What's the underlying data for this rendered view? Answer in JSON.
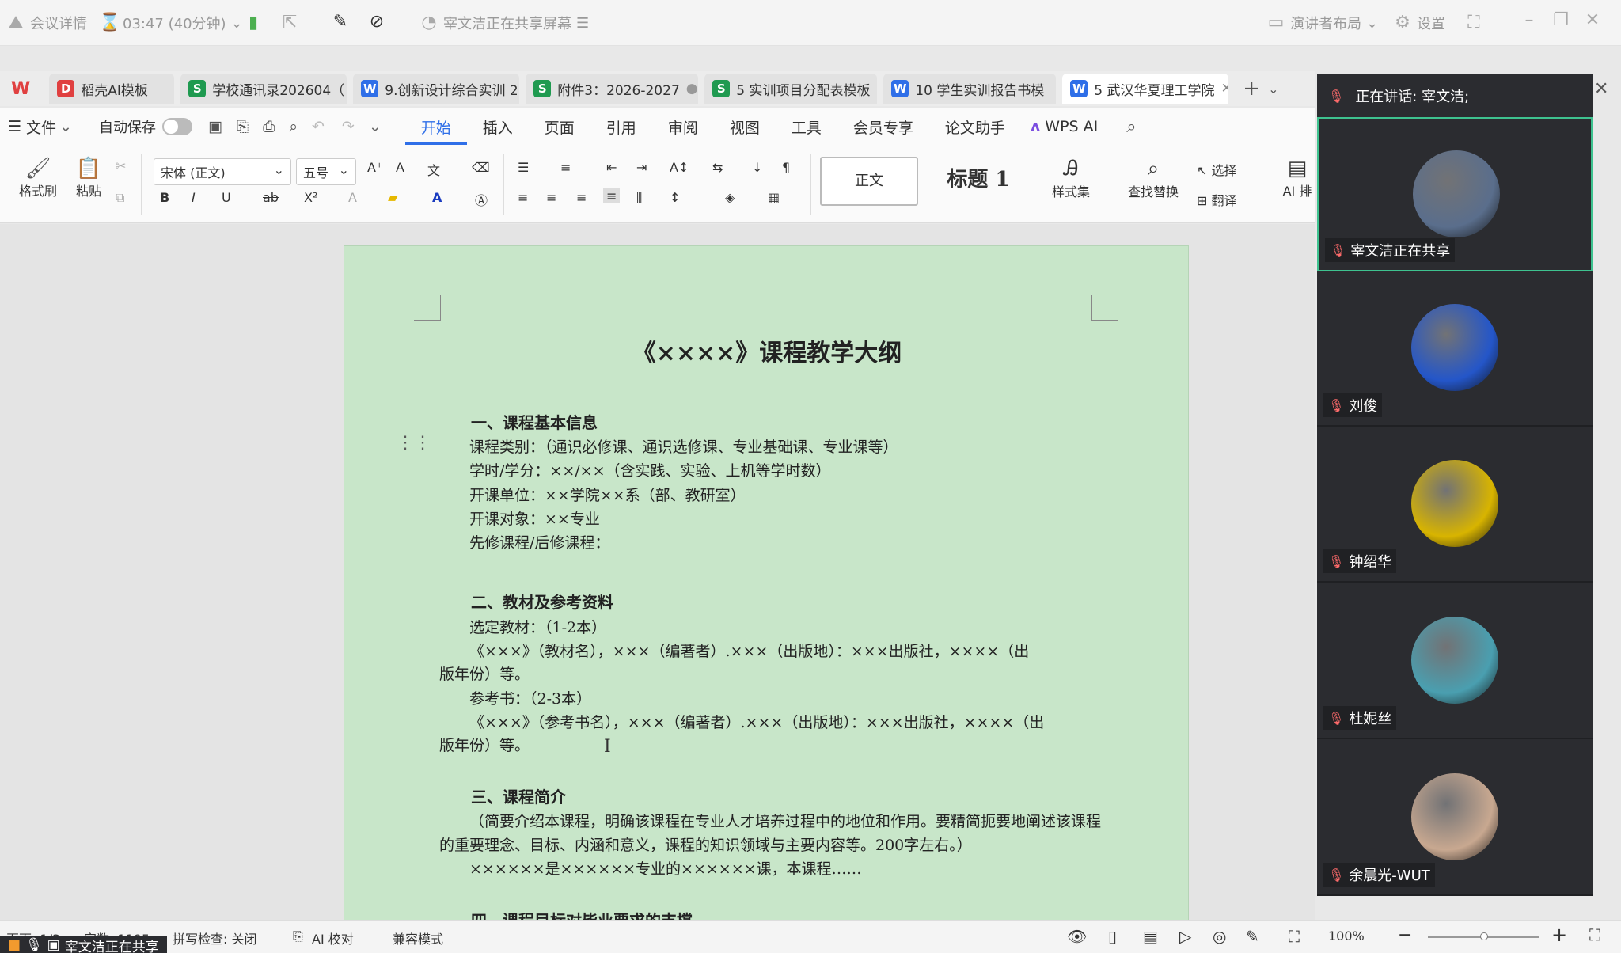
{
  "meeting": {
    "details_label": "会议详情",
    "timer": "03:47 (40分钟)",
    "sharing_status": "宰文洁正在共享屏幕",
    "presenter_layout": "演讲者布局",
    "settings": "设置"
  },
  "tabs": [
    {
      "icon": "D",
      "label": "稻壳AI模板"
    },
    {
      "icon": "S",
      "label": "学校通讯录202604（"
    },
    {
      "icon": "W",
      "label": "9.创新设计综合实训 2"
    },
    {
      "icon": "S",
      "label": "附件3：2026-2027"
    },
    {
      "icon": "S",
      "label": "5 实训项目分配表模板"
    },
    {
      "icon": "W",
      "label": "10 学生实训报告书模"
    },
    {
      "icon": "W",
      "label": "5 武汉华夏理工学院"
    }
  ],
  "menu": {
    "file": "文件",
    "autosave": "自动保存",
    "items": [
      "开始",
      "插入",
      "页面",
      "引用",
      "审阅",
      "视图",
      "工具",
      "会员专享",
      "论文助手"
    ],
    "wps_ai": "WPS AI"
  },
  "ribbon": {
    "format_painter": "格式刷",
    "paste": "粘贴",
    "font": "宋体 (正文)",
    "size": "五号",
    "style_normal": "正文",
    "style_heading": "标题 1",
    "style_set": "样式集",
    "find_replace": "查找替换",
    "select": "选择",
    "translate": "翻译",
    "ai_layout": "AI 排"
  },
  "document": {
    "title": "《××××》课程教学大纲",
    "lines": [
      {
        "t": "一、课程基本信息",
        "h": true
      },
      {
        "t": "课程类别：（通识必修课、通识选修课、专业基础课、专业课等）"
      },
      {
        "t": "学时/学分：××/××（含实践、实验、上机等学时数）"
      },
      {
        "t": "开课单位：××学院××系（部、教研室）"
      },
      {
        "t": "开课对象：××专业"
      },
      {
        "t": "先修课程/后修课程："
      },
      {
        "t": "二、教材及参考资料",
        "h": true
      },
      {
        "t": "选定教材：（1-2本）"
      },
      {
        "t": "《×××》（教材名），×××（编著者）.×××（出版地）：×××出版社，××××（出"
      },
      {
        "t": "版年份）等。"
      },
      {
        "t": "参考书：（2-3本）"
      },
      {
        "t": "《×××》（参考书名），×××（编著者）.×××（出版地）：×××出版社，××××（出"
      },
      {
        "t": "版年份）等。"
      },
      {
        "t": "三、课程简介",
        "h": true
      },
      {
        "t": "（简要介绍本课程，明确该课程在专业人才培养过程中的地位和作用。要精简扼要地阐述该课程"
      },
      {
        "t": "的重要理念、目标、内涵和意义，课程的知识领域与主要内容等。200字左右。）"
      },
      {
        "t": "××××××是××××××专业的××××××课，本课程……"
      },
      {
        "t": "四、课程目标对毕业要求的支撑",
        "h": true
      }
    ]
  },
  "status": {
    "page": "页面: 1/3",
    "words": "字数: 1195",
    "spellcheck": "拼写检查: 关闭",
    "ai_check": "AI 校对",
    "compat": "兼容模式",
    "zoom": "100%",
    "sharing": "宰文洁正在共享"
  },
  "panel": {
    "speaking": "正在讲话:  宰文洁;",
    "participants": [
      {
        "name": "宰文洁正在共享",
        "color": "#5a6e8c"
      },
      {
        "name": "刘俊",
        "color": "#2456c9"
      },
      {
        "name": "钟绍华",
        "color": "#d8b400"
      },
      {
        "name": "杜妮丝",
        "color": "#4a9fb0"
      },
      {
        "name": "余晨光-WUT",
        "color": "#c8a890"
      }
    ]
  }
}
